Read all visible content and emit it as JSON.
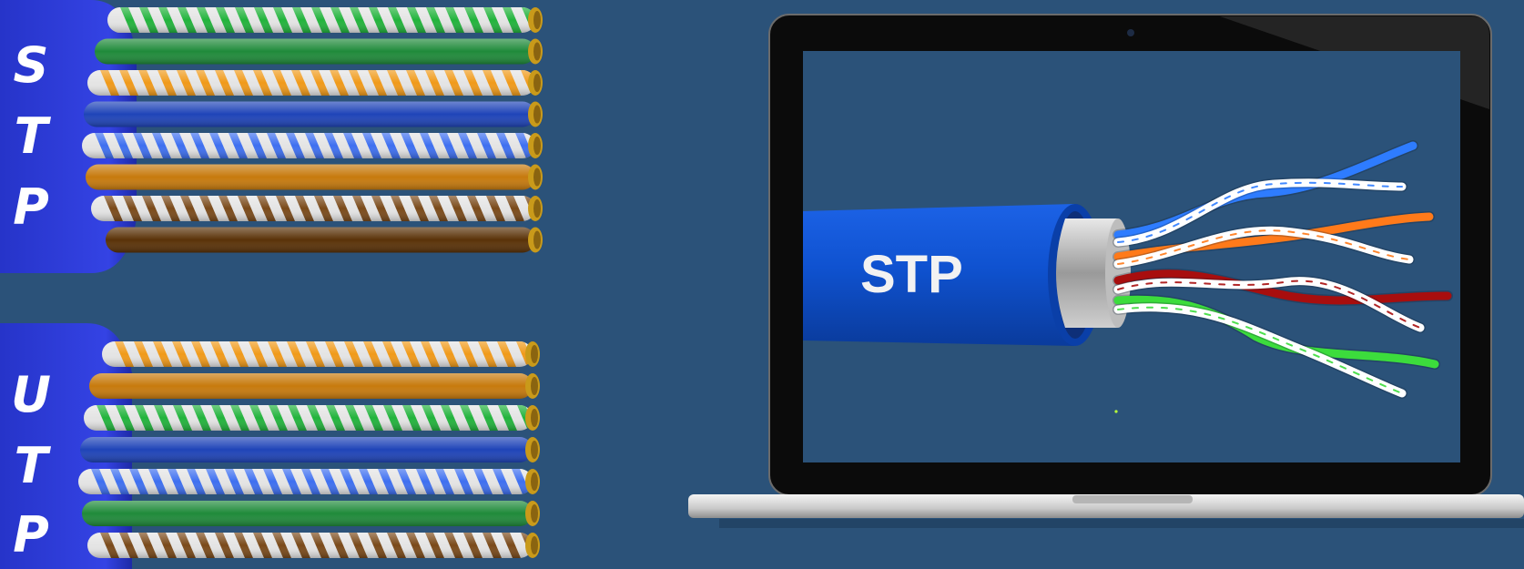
{
  "stp_label_letters": [
    "S",
    "T",
    "P"
  ],
  "utp_label_letters": [
    "U",
    "T",
    "P"
  ],
  "screen_label": "STP",
  "colors": {
    "background": "#2b5279",
    "jacket": "#2c3bd6",
    "copper": "#c99a1a",
    "stripe_white": "#e6e6e6",
    "orange": "#d07a10",
    "green": "#1f8a3a",
    "blue": "#1f44b8",
    "brown": "#5a3208"
  },
  "stp_wires": [
    {
      "kind": "striped",
      "color": "#22b33c"
    },
    {
      "kind": "solid",
      "color": "#1f8a3a"
    },
    {
      "kind": "striped",
      "color": "#f09a1a"
    },
    {
      "kind": "solid",
      "color": "#1f44b8"
    },
    {
      "kind": "striped",
      "color": "#3e6ff0"
    },
    {
      "kind": "solid",
      "color": "#c77a0d"
    },
    {
      "kind": "striped",
      "color": "#7a4a1a"
    },
    {
      "kind": "solid",
      "color": "#5a3208"
    }
  ],
  "utp_wires": [
    {
      "kind": "striped",
      "color": "#f09a1a"
    },
    {
      "kind": "solid",
      "color": "#c77a0d"
    },
    {
      "kind": "striped",
      "color": "#22b33c"
    },
    {
      "kind": "solid",
      "color": "#1f44b8"
    },
    {
      "kind": "striped",
      "color": "#3e6ff0"
    },
    {
      "kind": "solid",
      "color": "#1f8a3a"
    },
    {
      "kind": "striped",
      "color": "#7a4a1a"
    }
  ],
  "fan_wires": [
    {
      "color": "#2e7cff"
    },
    {
      "color": "#ffffff"
    },
    {
      "color": "#ff7a1a"
    },
    {
      "color": "#ffffff"
    },
    {
      "color": "#a80e0e"
    },
    {
      "color": "#ffffff"
    },
    {
      "color": "#3cdc3c"
    },
    {
      "color": "#ffffff"
    }
  ]
}
